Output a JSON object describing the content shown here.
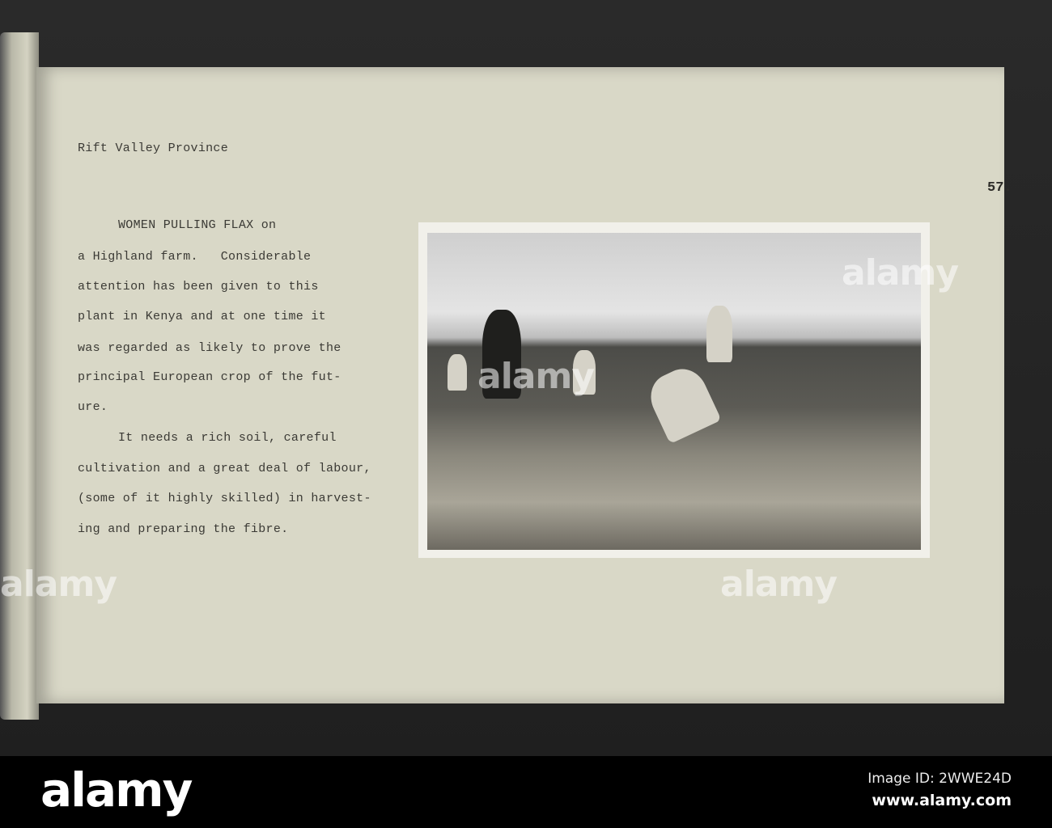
{
  "page": {
    "number": "57.",
    "heading": "Rift Valley Province",
    "caption_lines": [
      "WOMEN PULLING FLAX on",
      "a Highland farm.   Considerable",
      "attention has been given to this",
      "plant in Kenya and at one time it",
      "was regarded as likely to prove the",
      "principal European crop of the fut-",
      "ure.",
      "It needs a rich soil, careful",
      "cultivation and a great deal of labour,",
      "(some of it highly skilled) in harvest-",
      "ing and preparing the fibre."
    ]
  },
  "watermark": {
    "text": "alamy",
    "mark": "a"
  },
  "footer": {
    "logo": "alamy",
    "image_id": "Image ID: 2WWE24D",
    "site": "www.alamy.com"
  }
}
